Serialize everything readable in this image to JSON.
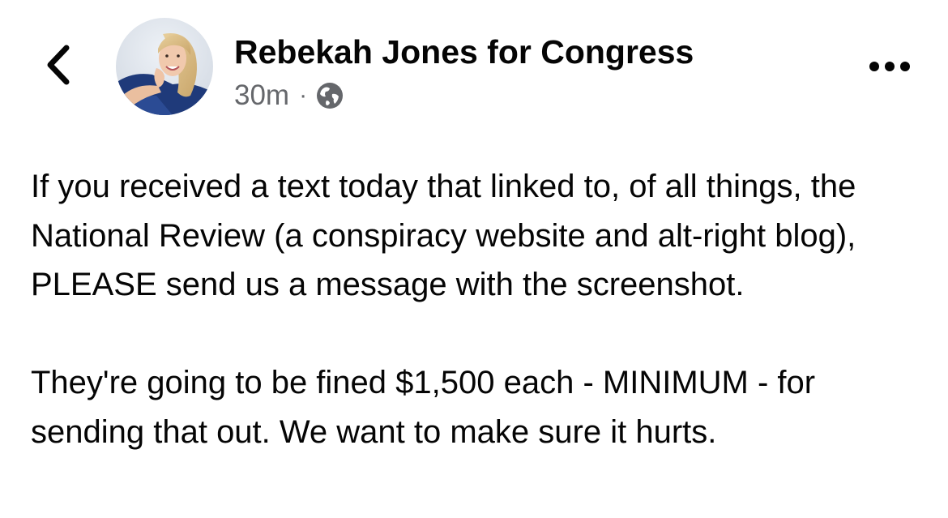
{
  "header": {
    "back_icon": "chevron-left-icon",
    "page_name": "Rebekah Jones for Congress",
    "timestamp": "30m",
    "separator": "·",
    "privacy_icon": "globe-icon",
    "more_icon": "more-horizontal-icon"
  },
  "post": {
    "paragraphs": [
      "If you received a text today that linked to, of all things, the National Review (a conspiracy website and alt-right blog), PLEASE send us a message with the screenshot.",
      "They're going to be fined $1,500 each - MINIMUM - for sending that out. We want to make sure it hurts."
    ]
  },
  "colors": {
    "text_primary": "#050505",
    "text_secondary": "#65676b"
  }
}
